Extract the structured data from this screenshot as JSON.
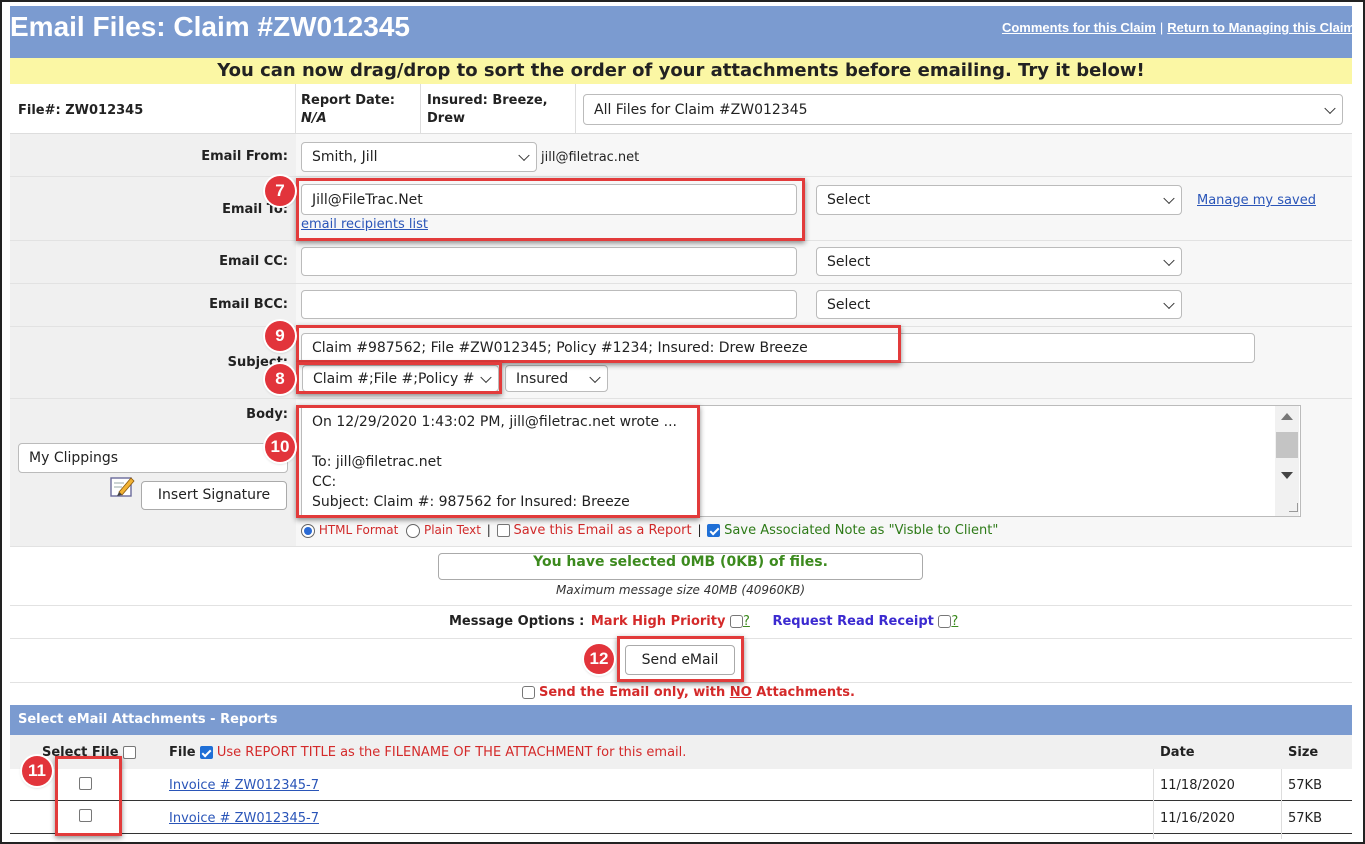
{
  "header": {
    "title": "Email Files: Claim #ZW012345",
    "link_comments": "Comments for this Claim",
    "separator": "|",
    "link_return": "Return to Managing this Claim"
  },
  "banner": "You can now drag/drop to sort the order of your attachments before emailing. Try it below!",
  "info": {
    "file_label": "File#: ZW012345",
    "report_date_label": "Report Date:",
    "report_date_value": "N/A",
    "insured_line1": "Insured: Breeze,",
    "insured_line2": "Drew",
    "files_select": "All Files for Claim #ZW012345"
  },
  "form": {
    "email_from_label": "Email From:",
    "email_from_value": "Smith, Jill",
    "email_from_address": "jill@filetrac.net",
    "email_to_label": "Email To:",
    "email_to_value": "Jill@FileTrac.Net",
    "email_recipients_link": "email recipients list",
    "email_to_select": "Select",
    "manage_saved_link": "Manage my saved",
    "email_cc_label": "Email CC:",
    "email_cc_select": "Select",
    "email_bcc_label": "Email BCC:",
    "email_bcc_select": "Select",
    "subject_label": "Subject:",
    "subject_value": "Claim #987562; File #ZW012345; Policy #1234; Insured: Drew Breeze",
    "subject_template_select": "Claim #;File #;Policy #",
    "subject_insured_select": "Insured",
    "body_label": "Body:",
    "body_lines": {
      "l1": "On 12/29/2020 1:43:02 PM, jill@filetrac.net wrote ...",
      "l2": "",
      "l3": "To: jill@filetrac.net",
      "l4": "CC:",
      "l5": "Subject: Claim #: 987562 for Insured: Breeze"
    },
    "clippings_select": "My Clippings",
    "insert_signature": "Insert Signature",
    "html_format": "HTML Format",
    "plain_text": "Plain Text",
    "save_as_report": "Save this Email as a Report",
    "save_note": "Save Associated Note as \"Visble to Client\""
  },
  "summary": {
    "selected_text": "You have selected 0MB (0KB) of files.",
    "max_size": "Maximum message size 40MB (40960KB)"
  },
  "options": {
    "label": "Message Options :",
    "high_priority": "Mark High Priority",
    "read_receipt": "Request Read Receipt",
    "help": "?"
  },
  "send": {
    "button": "Send eMail",
    "no_attachments": "Send the Email only, with",
    "no_word": "NO",
    "no_attachments_tail": "Attachments."
  },
  "attachments": {
    "section_title": "Select eMail Attachments - Reports",
    "col_select": "Select File",
    "col_file": "File",
    "use_title_note": "Use REPORT TITLE as the FILENAME OF THE ATTACHMENT for this email.",
    "col_date": "Date",
    "col_size": "Size",
    "rows": [
      {
        "file": "Invoice # ZW012345-7",
        "date": "11/18/2020",
        "size": "57KB"
      },
      {
        "file": "Invoice # ZW012345-7",
        "date": "11/16/2020",
        "size": "57KB"
      }
    ]
  },
  "callouts": {
    "c7": "7",
    "c8": "8",
    "c9": "9",
    "c10": "10",
    "c11": "11",
    "c12": "12"
  },
  "colors": {
    "header_blue": "#7b9bd0",
    "banner_yellow": "#fbf7a4",
    "callout_red": "#e2343b",
    "summary_green": "#3c8a1e",
    "high_priority_red": "#d42a2a",
    "read_receipt_blue": "#3b2ad0"
  }
}
